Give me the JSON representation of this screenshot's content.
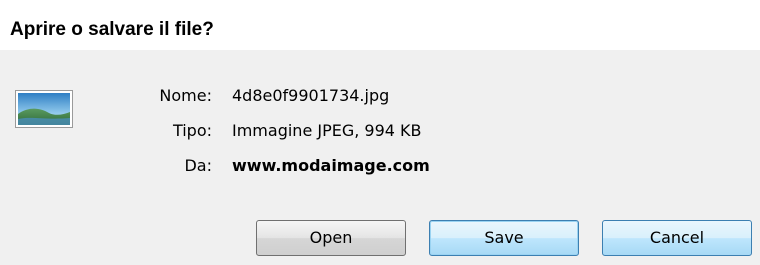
{
  "dialog": {
    "title": "Aprire o salvare il file?",
    "icon": "image-file-icon",
    "fields": {
      "name_label": "Nome:",
      "name_value": "4d8e0f9901734.jpg",
      "type_label": "Tipo:",
      "type_value": "Immagine JPEG, 994 KB",
      "from_label": "Da:",
      "from_value": "www.modaimage.com"
    },
    "buttons": {
      "open_label": "Open",
      "save_label": "Save",
      "cancel_label": "Cancel"
    },
    "colors": {
      "header_background": "#ffffff",
      "body_background": "#f0f0f0",
      "focused_button_border": "#3c7fb1"
    }
  }
}
